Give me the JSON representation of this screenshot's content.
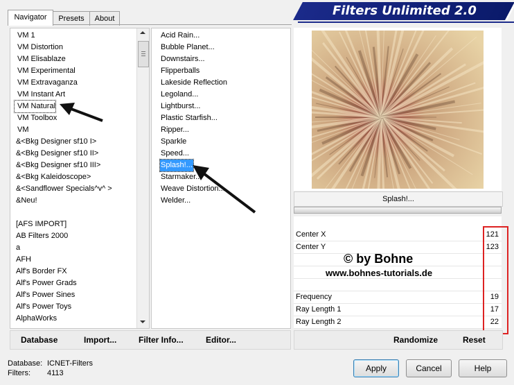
{
  "tabs": [
    "Navigator",
    "Presets",
    "About"
  ],
  "header": {
    "title": "Filters Unlimited 2.0"
  },
  "categories": [
    "VM 1",
    "VM Distortion",
    "VM Elisablaze",
    "VM Experimental",
    "VM Extravaganza",
    "VM Instant Art",
    "VM Natural",
    "VM Toolbox",
    "VM",
    "&<Bkg Designer sf10 I>",
    "&<Bkg Designer sf10 II>",
    "&<Bkg Designer sf10 III>",
    "&<Bkg Kaleidoscope>",
    "&<Sandflower Specials^v^ >",
    "&Neu!",
    "",
    "[AFS IMPORT]",
    "AB Filters 2000",
    "a",
    "AFH",
    "Alf's Border FX",
    "Alf's Power Grads",
    "Alf's Power Sines",
    "Alf's Power Toys",
    "AlphaWorks"
  ],
  "filters": [
    "Acid Rain...",
    "Bubble Planet...",
    "Downstairs...",
    "Flipperballs",
    "Lakeside Reflection",
    "Legoland...",
    "Lightburst...",
    "Plastic Starfish...",
    "Ripper...",
    "Sparkle",
    "Speed...",
    "Splash!...",
    "Starmaker...",
    "Weave Distortion...",
    "Welder..."
  ],
  "bottom_links": {
    "database": "Database",
    "import": "Import...",
    "filter_info": "Filter Info...",
    "editor": "Editor..."
  },
  "preview": {
    "filter_name": "Splash!...",
    "colors": {
      "center": "#a8403c",
      "mid": "#c9a07a",
      "outer": "#e8d3a6"
    }
  },
  "params": [
    {
      "label": "Center X",
      "value": "121"
    },
    {
      "label": "Center Y",
      "value": "123"
    },
    {
      "label": "",
      "value": ""
    },
    {
      "label": "",
      "value": ""
    },
    {
      "label": "",
      "value": ""
    },
    {
      "label": "Frequency",
      "value": "19"
    },
    {
      "label": "Ray Length 1",
      "value": "17"
    },
    {
      "label": "Ray Length 2",
      "value": "22"
    }
  ],
  "watermark": {
    "line1": "© by Bohne",
    "line2": "www.bohnes-tutorials.de"
  },
  "randomize": "Randomize",
  "reset": "Reset",
  "status": {
    "database_label": "Database:",
    "database_value": "ICNET-Filters",
    "filters_label": "Filters:",
    "filters_value": "4113"
  },
  "buttons": {
    "apply": "Apply",
    "cancel": "Cancel",
    "help": "Help"
  }
}
